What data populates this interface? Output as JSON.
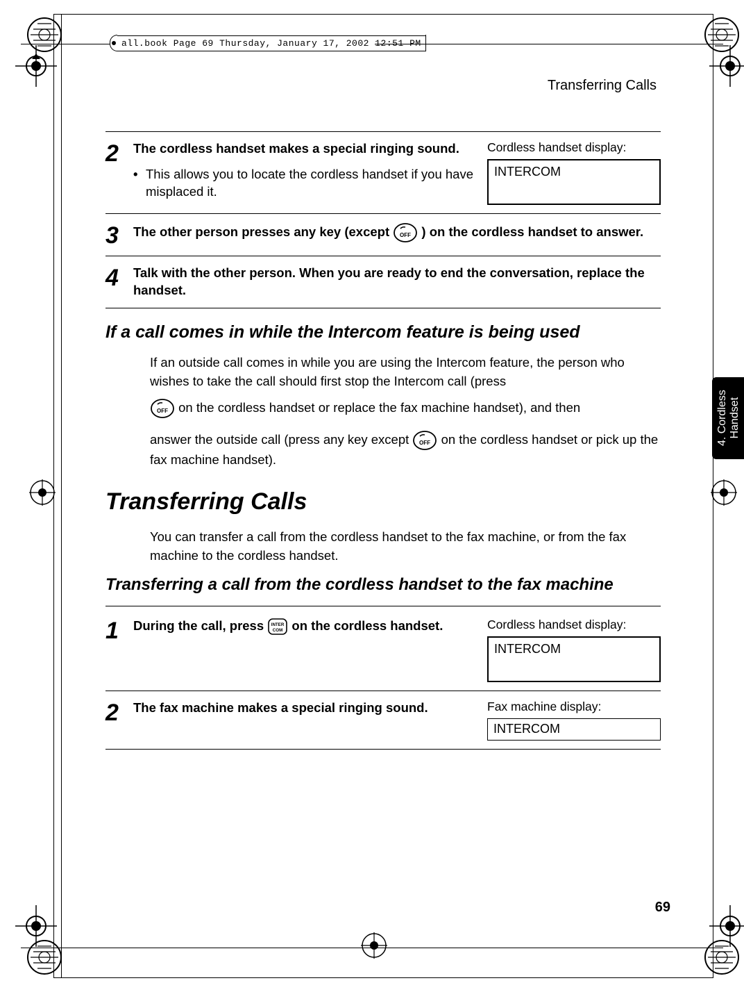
{
  "file_header": "all.book  Page 69  Thursday, January 17, 2002  12:51 PM",
  "running_head": "Transferring Calls",
  "side_tab": {
    "line1": "4. Cordless",
    "line2": "Handset"
  },
  "page_number": "69",
  "step2": {
    "num": "2",
    "title": "The cordless handset makes a special ringing sound.",
    "bullet": "This allows you to locate the cordless handset if you have misplaced it.",
    "display_label": "Cordless handset display:",
    "display_value": "INTERCOM"
  },
  "step3": {
    "num": "3",
    "text_before": "The other person presses any key (except ",
    "text_after": " ) on the cordless handset to answer."
  },
  "step4": {
    "num": "4",
    "text": "Talk with the other person. When you are ready to end the conversation, replace the handset."
  },
  "section_heading": "If a call comes in while the Intercom feature is being used",
  "para1": "If an outside call comes in while you are using the Intercom feature, the person who wishes to take the call should first stop the Intercom call (press",
  "para2_after_icon": " on the cordless handset or replace the fax machine handset), and then",
  "para3_before": "answer the outside call (press any key except ",
  "para3_after": " on the cordless handset or pick up the fax machine handset).",
  "main_title": "Transferring Calls",
  "intro_para": "You can transfer a call from the cordless handset to the fax machine, or from the fax machine to the cordless handset.",
  "sub_heading": "Transferring a call from the cordless handset to the fax machine",
  "t_step1": {
    "num": "1",
    "before": "During the call, press ",
    "after": " on the cordless handset.",
    "display_label": "Cordless handset display:",
    "display_value": "INTERCOM"
  },
  "t_step2": {
    "num": "2",
    "text": "The fax machine makes a special ringing sound.",
    "display_label": "Fax machine display:",
    "display_value": "INTERCOM"
  }
}
